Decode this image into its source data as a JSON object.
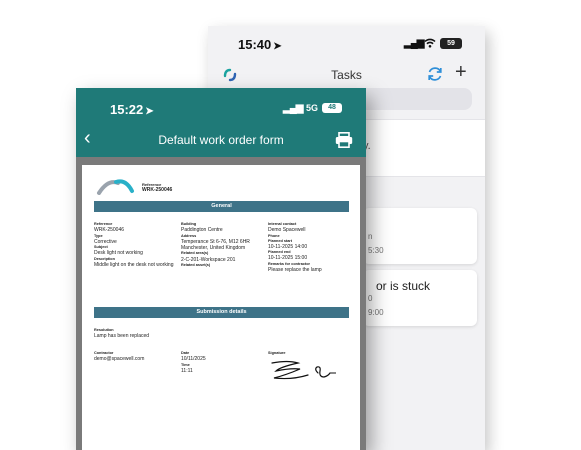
{
  "back_phone": {
    "status": {
      "time": "15:40",
      "location_arrow": "◀",
      "signal": "▂▄▆",
      "wifi": "wifi-icon",
      "battery": "59"
    },
    "header": {
      "title": "Tasks",
      "logo": "spacewell-logo-icon",
      "sync_icon": "sync-icon",
      "add_label": "+"
    },
    "tasks": [
      {
        "title": "",
        "line2": "n",
        "time": "5:30"
      },
      {
        "title": "or is stuck",
        "line2": "0",
        "time": "9:00"
      }
    ],
    "band_text": "y."
  },
  "front_phone": {
    "status": {
      "time": "15:22",
      "location_arrow": "◀",
      "signal": "▂▄▆",
      "network": "5G",
      "battery": "48"
    },
    "header": {
      "back_label": "‹",
      "title": "Default work order form",
      "print_icon": "printer-icon"
    }
  },
  "document": {
    "header": {
      "reference_label": "Reference",
      "reference_value": "WRK-250046"
    },
    "general_title": "General",
    "general": {
      "col1": [
        {
          "label": "Reference",
          "value": "WRK-250046"
        },
        {
          "label": "Type",
          "value": "Corrective"
        },
        {
          "label": "Subject",
          "value": "Desk light not working"
        },
        {
          "label": "Description",
          "value": "Middle light on the desk not working"
        }
      ],
      "col2": [
        {
          "label": "Building",
          "value": "Paddington Centre"
        },
        {
          "label": "Address",
          "value": "Temperance St 6-76, M12 6HR Manchester, United Kingdom"
        },
        {
          "label": "Related area(s)",
          "value": "2-C-201-Workspace 201"
        },
        {
          "label": "Related asset(s)",
          "value": ""
        }
      ],
      "col3": [
        {
          "label": "Internal contact",
          "value": "Demo Spacewell"
        },
        {
          "label": "Phone",
          "value": ""
        },
        {
          "label": "Planned start",
          "value": "10-11-2025 14:00"
        },
        {
          "label": "Planned end",
          "value": "10-11-2025 15:00"
        },
        {
          "label": "Remarks for contractor",
          "value": "Please replace the lamp"
        }
      ]
    },
    "submission_title": "Submission details",
    "submission": {
      "resolution_label": "Resolution",
      "resolution_value": "Lamp has been replaced",
      "contractor_label": "Contractor",
      "contractor_value": "demo@spacewell.com",
      "date_label": "Date",
      "date_value": "10/11/2025",
      "time_label": "Time",
      "time_value": "11:11",
      "signature_label": "Signature"
    }
  },
  "colors": {
    "teal": "#1f7a78",
    "doc_bar": "#3e7388",
    "back_sync": "#2f8fd8"
  }
}
